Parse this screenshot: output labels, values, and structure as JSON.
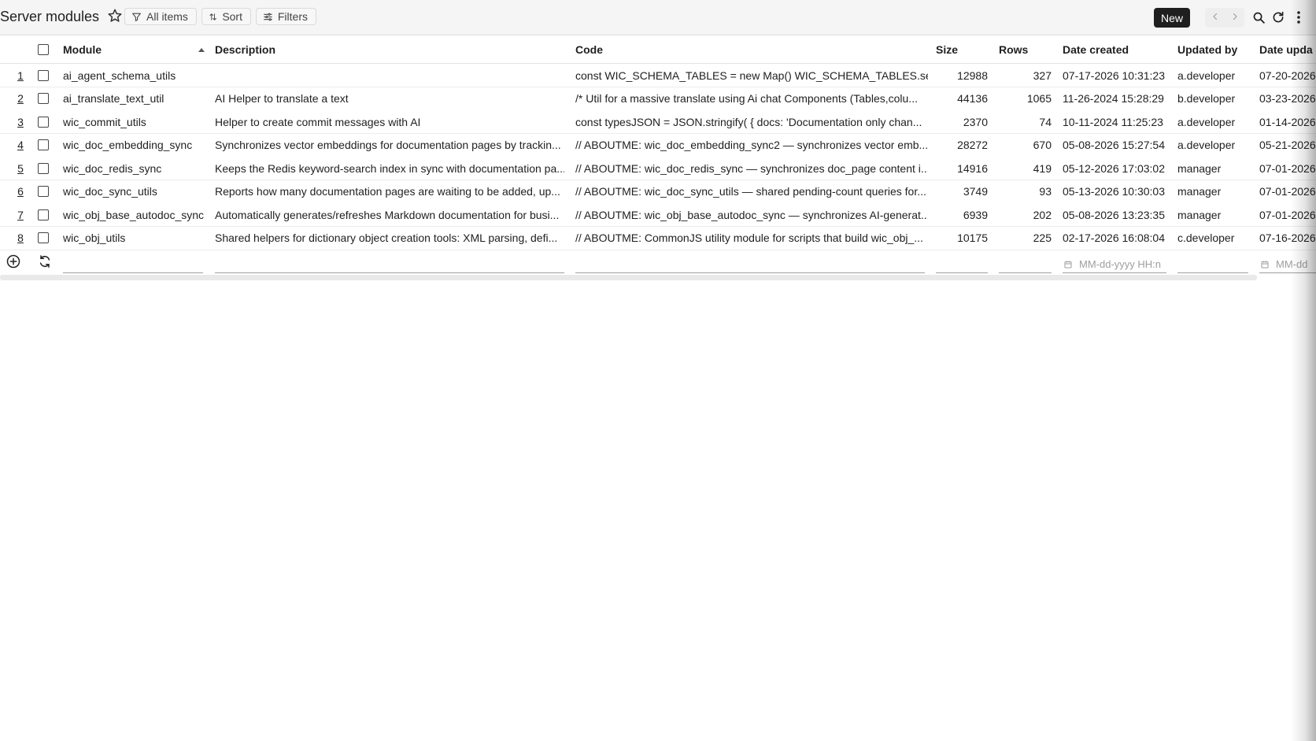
{
  "toolbar": {
    "title": "Server modules",
    "all_items": "All items",
    "sort": "Sort",
    "filters": "Filters",
    "new": "New"
  },
  "columns": {
    "module": "Module",
    "description": "Description",
    "code": "Code",
    "size": "Size",
    "rows": "Rows",
    "date_created": "Date created",
    "updated_by": "Updated by",
    "date_updated": "Date upda"
  },
  "rows": [
    {
      "n": "1",
      "module": "ai_agent_schema_utils",
      "description": "",
      "code": "const WIC_SCHEMA_TABLES = new Map() WIC_SCHEMA_TABLES.se...",
      "size": "12988",
      "rows": "327",
      "created": "07-17-2026 10:31:23",
      "updated_by": "a.developer",
      "updated": "07-20-2026"
    },
    {
      "n": "2",
      "module": "ai_translate_text_util",
      "description": "AI Helper to translate a text",
      "code": "/* Util for a massive translate using Ai chat Components (Tables,colu...",
      "size": "44136",
      "rows": "1065",
      "created": "11-26-2024 15:28:29",
      "updated_by": "b.developer",
      "updated": "03-23-2026"
    },
    {
      "n": "3",
      "module": "wic_commit_utils",
      "description": "Helper to create commit messages with AI",
      "code": "const typesJSON = JSON.stringify( { docs: 'Documentation only chan...",
      "size": "2370",
      "rows": "74",
      "created": "10-11-2024 11:25:23",
      "updated_by": "a.developer",
      "updated": "01-14-2026"
    },
    {
      "n": "4",
      "module": "wic_doc_embedding_sync",
      "description": "Synchronizes vector embeddings for documentation pages by trackin...",
      "code": "// ABOUTME: wic_doc_embedding_sync2 — synchronizes vector emb...",
      "size": "28272",
      "rows": "670",
      "created": "05-08-2026 15:27:54",
      "updated_by": "a.developer",
      "updated": "05-21-2026"
    },
    {
      "n": "5",
      "module": "wic_doc_redis_sync",
      "description": "Keeps the Redis keyword-search index in sync with documentation pa...",
      "code": "// ABOUTME: wic_doc_redis_sync — synchronizes doc_page content i...",
      "size": "14916",
      "rows": "419",
      "created": "05-12-2026 17:03:02",
      "updated_by": "manager",
      "updated": "07-01-2026"
    },
    {
      "n": "6",
      "module": "wic_doc_sync_utils",
      "description": "Reports how many documentation pages are waiting to be added, up...",
      "code": "// ABOUTME: wic_doc_sync_utils — shared pending-count queries for...",
      "size": "3749",
      "rows": "93",
      "created": "05-13-2026 10:30:03",
      "updated_by": "manager",
      "updated": "07-01-2026"
    },
    {
      "n": "7",
      "module": "wic_obj_base_autodoc_sync",
      "description": "Automatically generates/refreshes Markdown documentation for busi...",
      "code": "// ABOUTME: wic_obj_base_autodoc_sync — synchronizes AI-generat...",
      "size": "6939",
      "rows": "202",
      "created": "05-08-2026 13:23:35",
      "updated_by": "manager",
      "updated": "07-01-2026"
    },
    {
      "n": "8",
      "module": "wic_obj_utils",
      "description": "Shared helpers for dictionary object creation tools: XML parsing, defi...",
      "code": "// ABOUTME: CommonJS utility module for scripts that build wic_obj_...",
      "size": "10175",
      "rows": "225",
      "created": "02-17-2026 16:08:04",
      "updated_by": "c.developer",
      "updated": "07-16-2026"
    }
  ],
  "new_row": {
    "date_placeholder": "MM-dd-yyyy HH:n",
    "date_placeholder_2": "MM-dd"
  },
  "icons": {
    "star": "star-icon",
    "all_items": "filter-funnel-icon",
    "sort": "sort-arrows-icon",
    "filters": "sliders-icon",
    "prev": "chevron-left-icon",
    "next": "chevron-right-icon",
    "search": "search-icon",
    "refresh": "refresh-icon",
    "more": "more-vertical-icon",
    "add_row": "add-circle-icon",
    "reset_row": "reset-icon",
    "calendar": "calendar-icon"
  },
  "colors": {
    "toolbar_bg": "#f5f5f5",
    "new_button_bg": "#1f1f1f",
    "text": "#1f1f1f",
    "placeholder": "#9e9e9e"
  }
}
